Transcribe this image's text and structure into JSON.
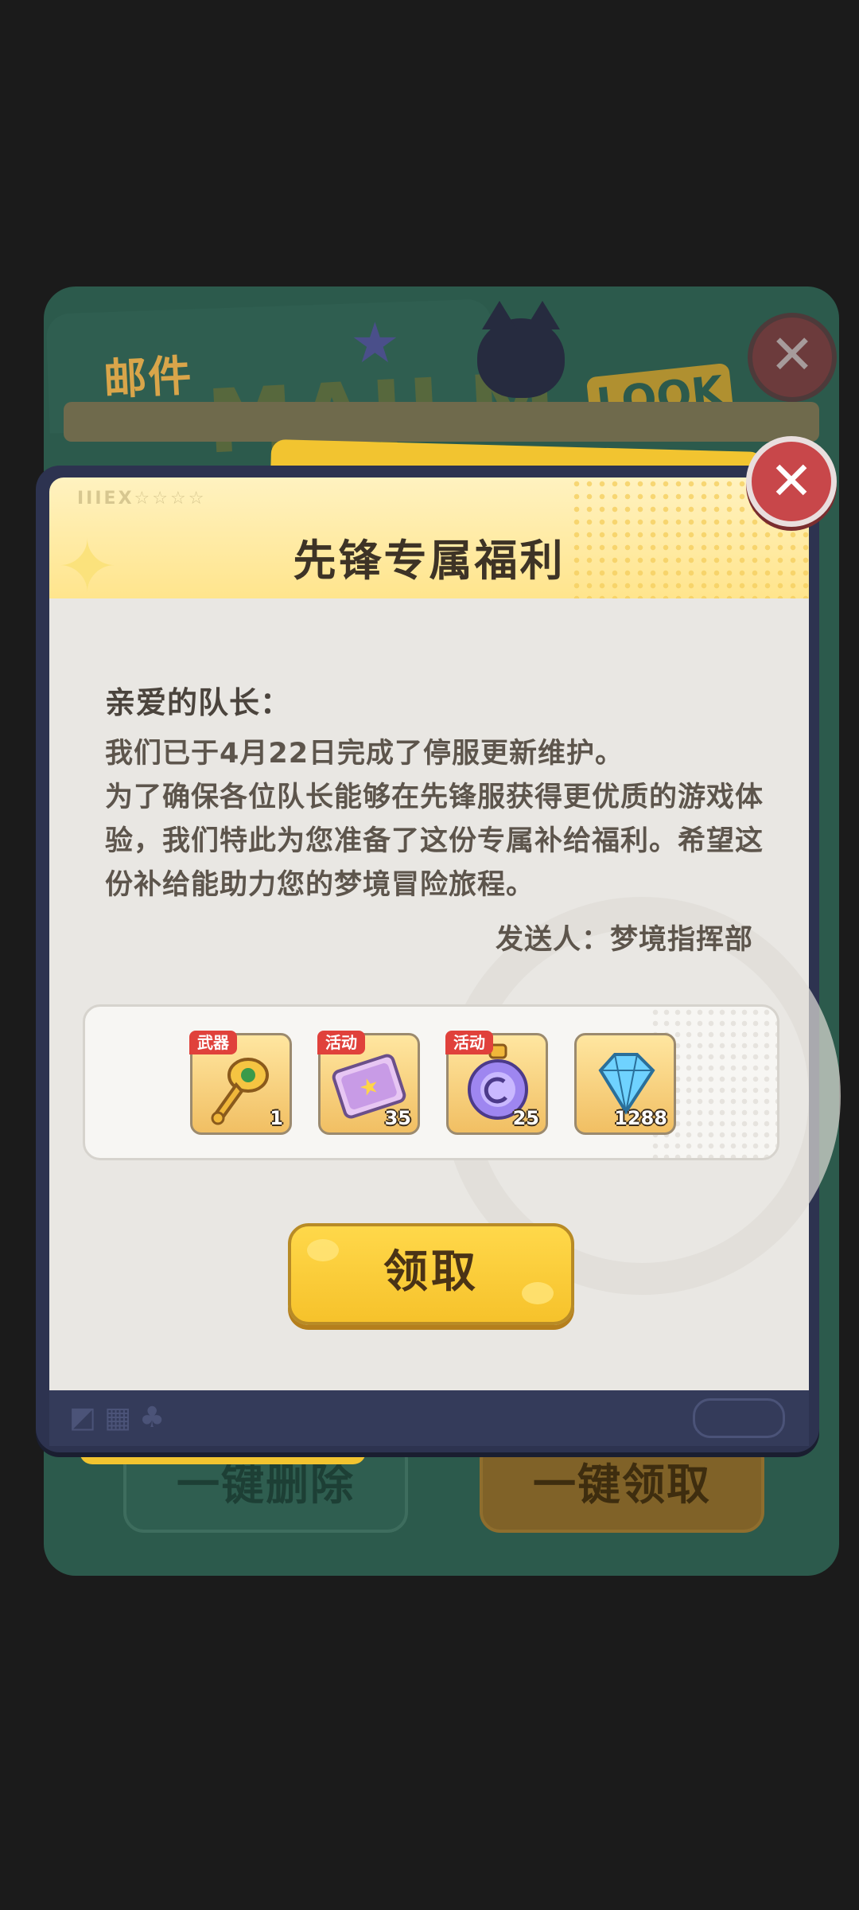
{
  "background": {
    "mail_title": "邮件",
    "watermark": "MAILM",
    "look_label": "LOOK",
    "delete_all_label": "一键删除",
    "claim_all_label": "一键领取"
  },
  "dialog": {
    "title": "先锋专属福利",
    "header_deco": "IIIEX☆☆☆☆",
    "salutation": "亲爱的队长：",
    "message_lines": [
      "我们已于4月22日完成了停服更新维护。",
      "为了确保各位队长能够在先锋服获得更优质的游戏体验，我们特此为您准备了这份专属补给福利。希望这份补给能助力您的梦境冒险旅程。"
    ],
    "sender": "发送人：梦境指挥部",
    "rewards": [
      {
        "tag": "武器",
        "count": "1",
        "icon": "golden-staff-icon"
      },
      {
        "tag": "活动",
        "count": "35",
        "icon": "event-ticket-icon"
      },
      {
        "tag": "活动",
        "count": "25",
        "icon": "potion-bottle-icon"
      },
      {
        "tag": "",
        "count": "1288",
        "icon": "diamond-icon"
      }
    ],
    "claim_label": "领取",
    "close_icon": "close-icon"
  },
  "colors": {
    "accent_yellow": "#f6c22b",
    "close_red": "#c8474a",
    "frame_navy": "#2d3350",
    "tag_red": "#e0413b"
  }
}
